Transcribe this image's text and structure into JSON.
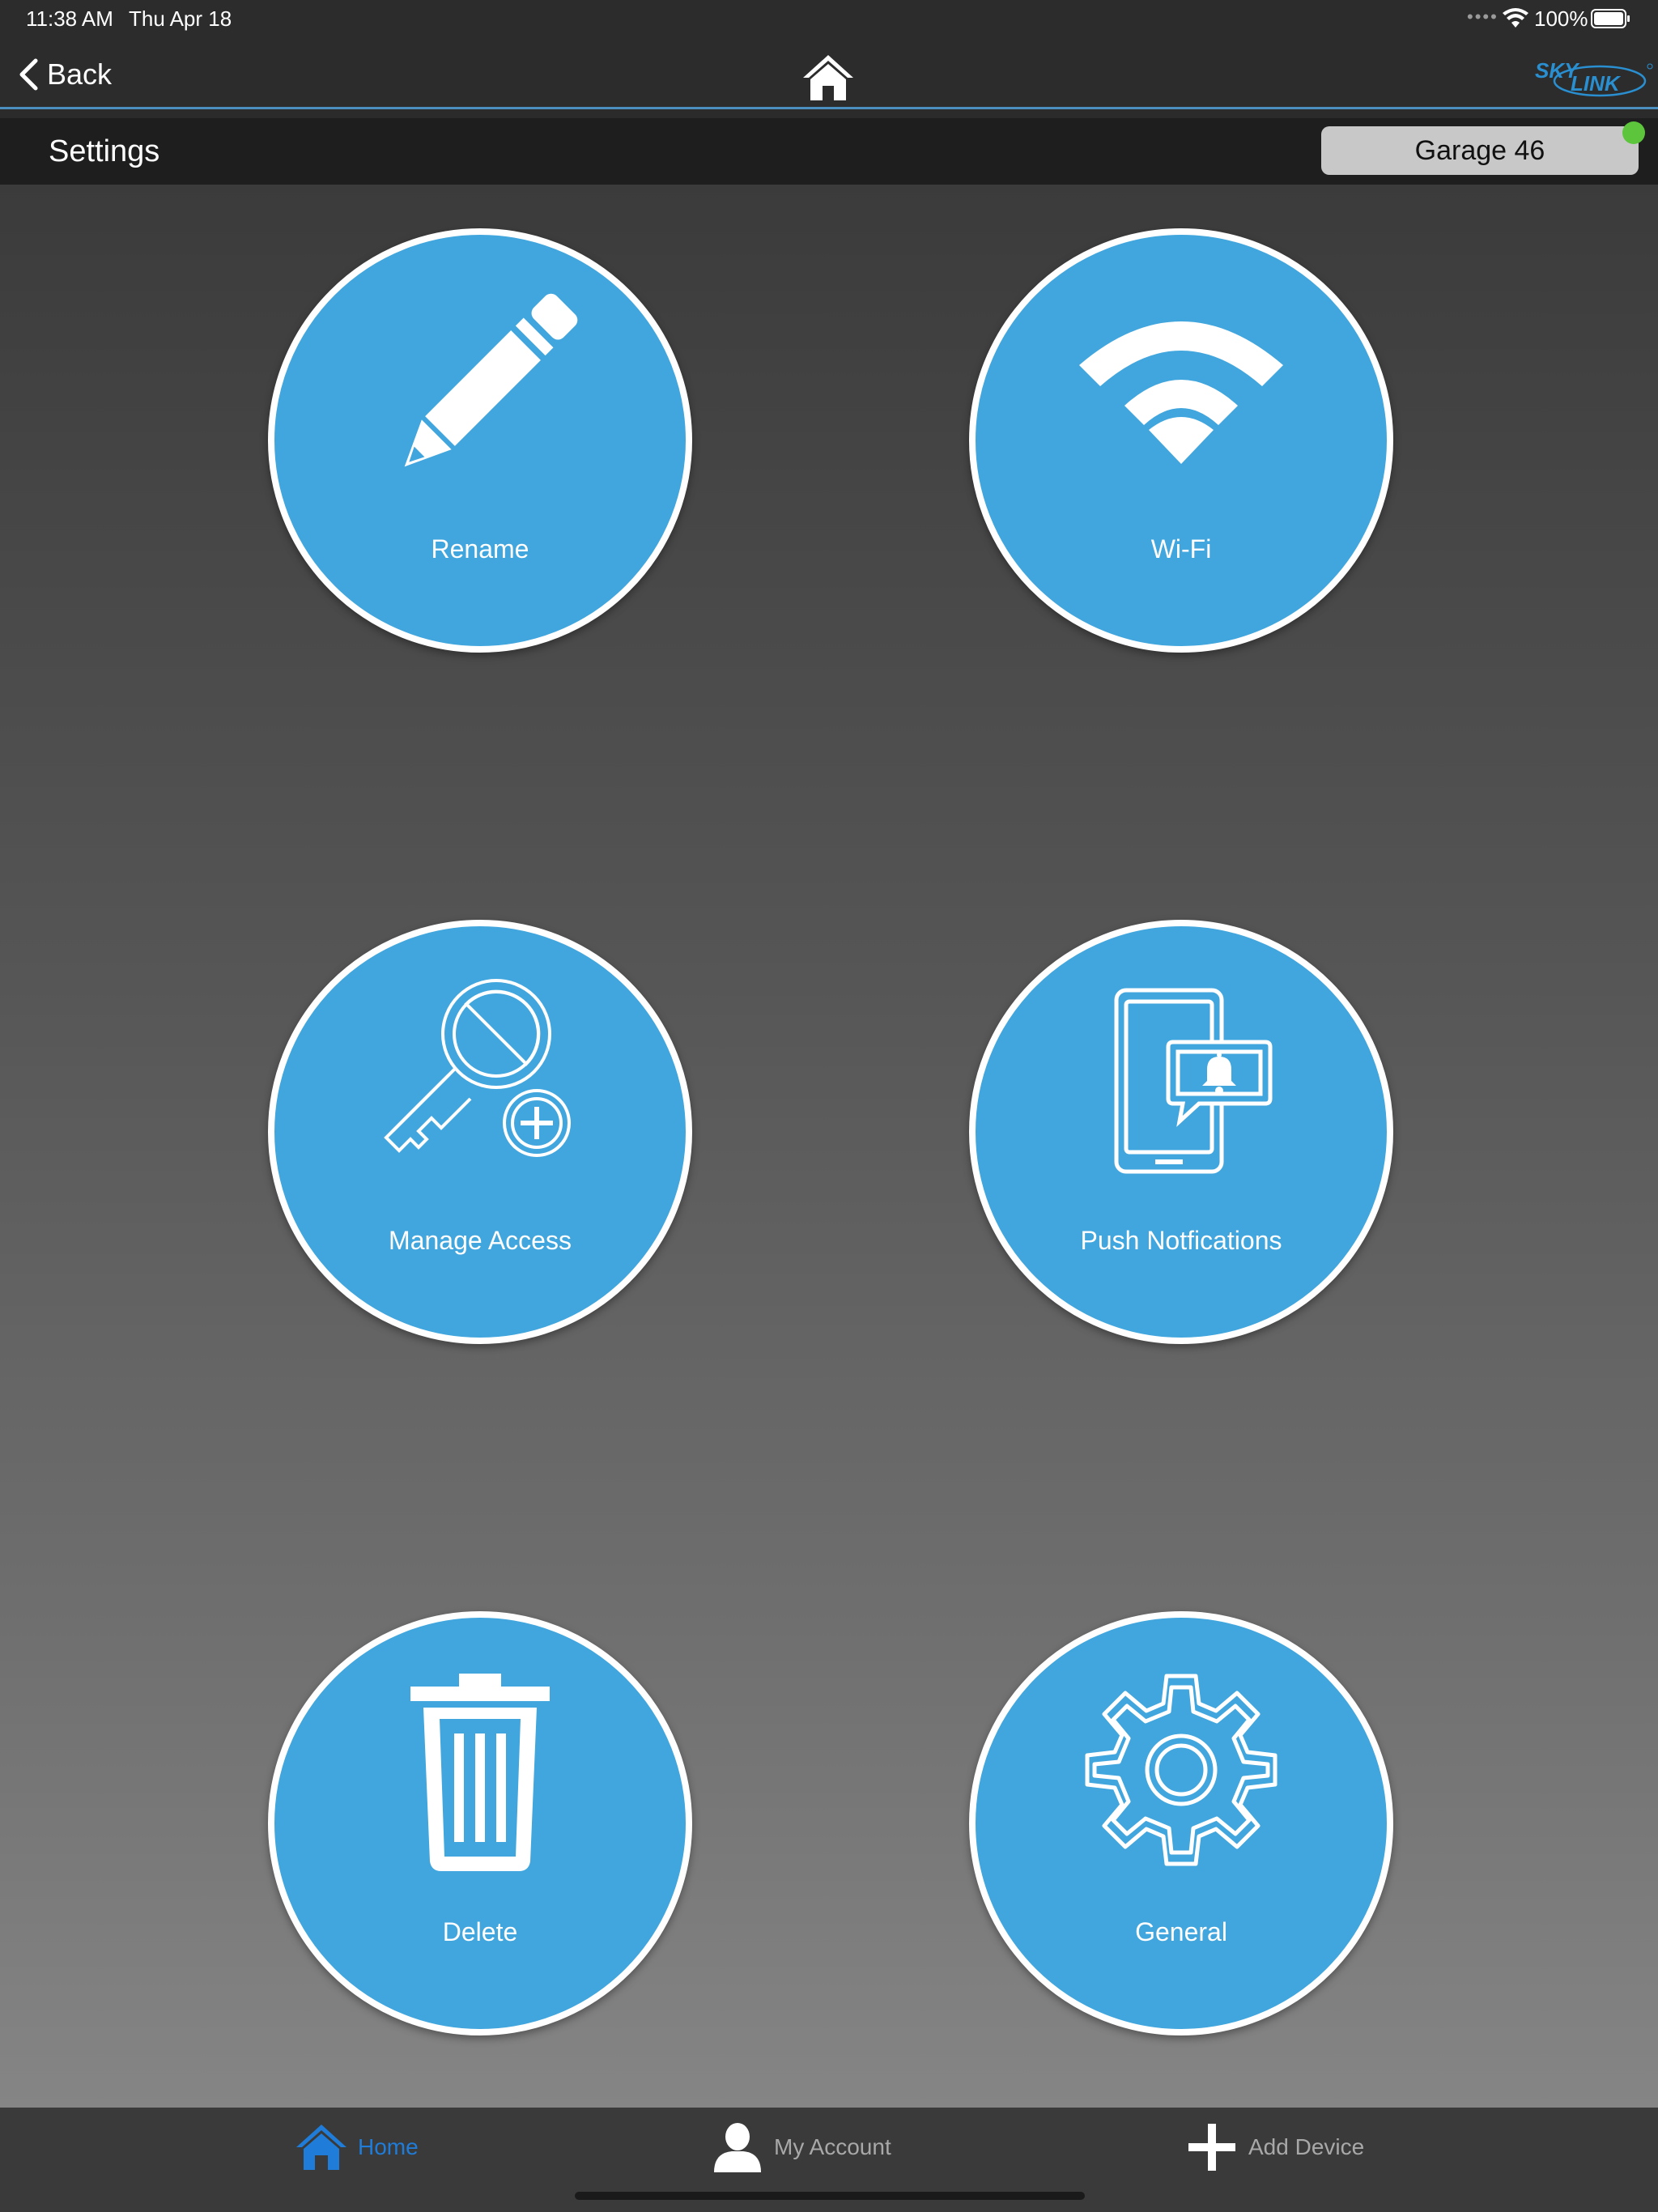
{
  "status_bar": {
    "time": "11:38 AM",
    "date": "Thu Apr 18",
    "battery": "100%"
  },
  "nav": {
    "back_label": "Back",
    "brand_logo_text": "SKY LINK"
  },
  "header": {
    "title": "Settings",
    "device_name": "Garage 46",
    "device_online": true
  },
  "tiles": [
    {
      "label": "Rename",
      "icon": "pencil-icon"
    },
    {
      "label": "Wi-Fi",
      "icon": "wifi-icon"
    },
    {
      "label": "Manage Access",
      "icon": "key-add-icon"
    },
    {
      "label": "Push Notfications",
      "icon": "phone-notification-icon"
    },
    {
      "label": "Delete",
      "icon": "trash-icon"
    },
    {
      "label": "General",
      "icon": "gear-icon"
    }
  ],
  "tab_bar": {
    "home": "Home",
    "account": "My Account",
    "add_device": "Add Device",
    "active": "home"
  },
  "colors": {
    "tile_fill": "#41a6dd",
    "accent_blue": "#1f7cd8",
    "online_green": "#5cc53c"
  }
}
